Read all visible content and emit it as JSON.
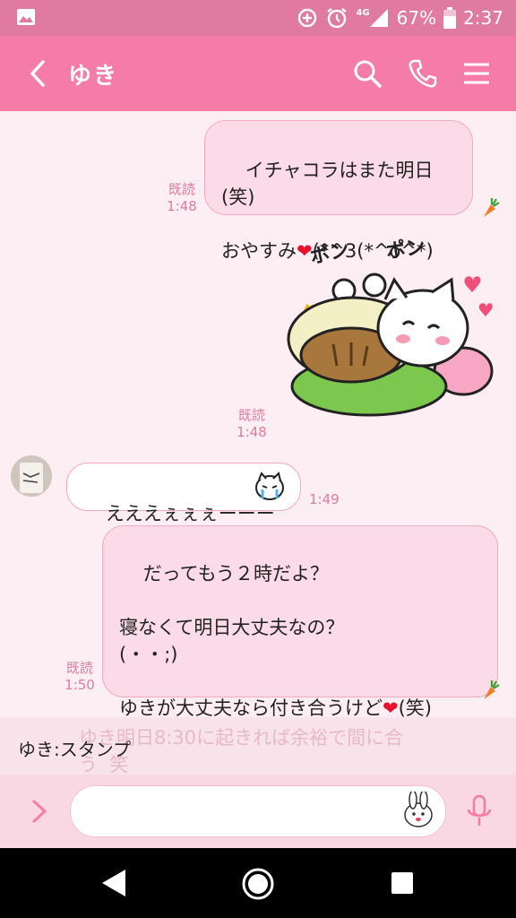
{
  "status_bar": {
    "network": "4G",
    "battery": "67%",
    "time": "2:37"
  },
  "header": {
    "contact_name": "ゆき"
  },
  "messages": [
    {
      "from": "me",
      "text": "イチャコラはまた明日(笑)\n\nおやすみ❤(*^3(*^o^*)",
      "read": "既読",
      "time": "1:48"
    },
    {
      "from": "me",
      "type": "sticker",
      "read": "既読",
      "time": "1:48",
      "sticker_text_1": "ポン",
      "sticker_text_2": "ポン"
    },
    {
      "from": "yuki",
      "text": "えええぇぇぇーーー",
      "time": "1:49"
    },
    {
      "from": "me",
      "text": "だってもう２時だよ？\n\n寝なくて明日大丈夫なの？\n(・・;)\n\nゆきが大丈夫なら付き合うけど❤(笑)",
      "read": "既読",
      "time": "1:50"
    }
  ],
  "preview": {
    "partial_text": "ゆき明日8:30に起きれば余裕で間に合\nう  笑",
    "sender_label": "ゆき:スタンプ"
  },
  "colors": {
    "accent": "#f67ca8",
    "status_bar": "#e07a9f",
    "background": "#fdeef3",
    "outgoing_bubble": "#fbdbe7",
    "heart": "#e8102a"
  }
}
